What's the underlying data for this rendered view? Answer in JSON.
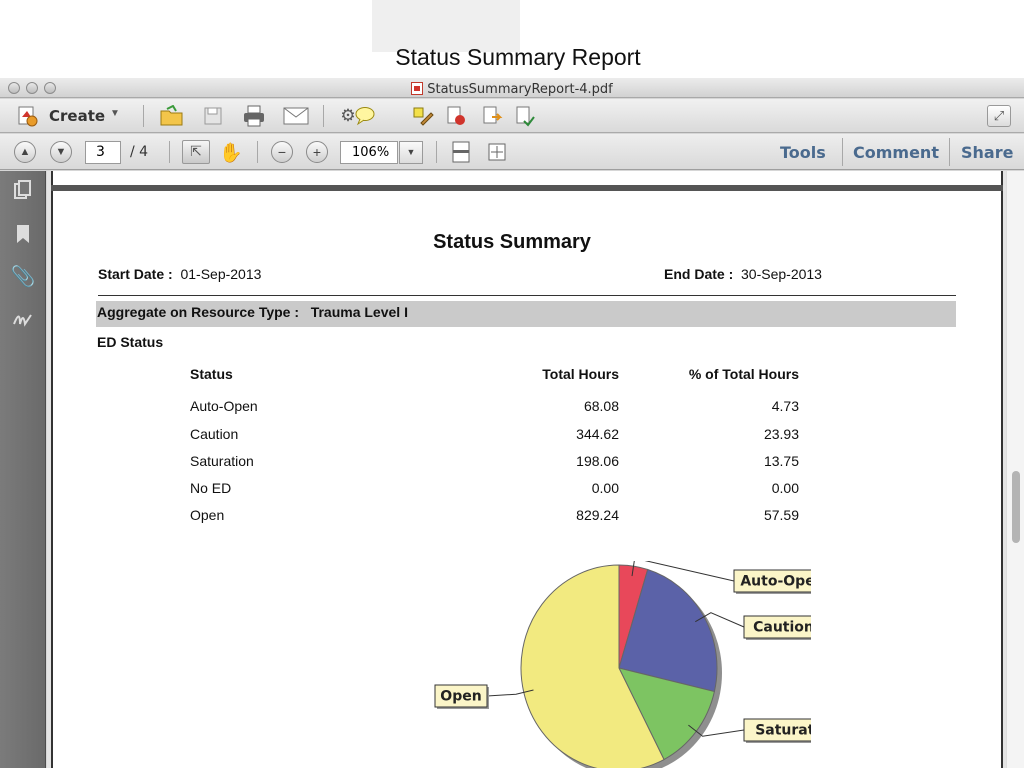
{
  "slide": {
    "title": "Status Summary Report"
  },
  "window": {
    "title": "StatusSummaryReport-4.pdf"
  },
  "toolbar": {
    "create_label": "Create",
    "page_current": "3",
    "page_total": "/ 4",
    "zoom": "106%",
    "tools_label": "Tools",
    "comment_label": "Comment",
    "share_label": "Share"
  },
  "document": {
    "heading": "Status Summary",
    "start_date_label": "Start Date :",
    "start_date": "01-Sep-2013",
    "end_date_label": "End Date  :",
    "end_date": "30-Sep-2013",
    "aggregate_label": "Aggregate on Resource Type :",
    "aggregate_value": "Trauma Level I",
    "section_title": "ED Status",
    "table": {
      "headers": [
        "Status",
        "Total Hours",
        "% of Total Hours"
      ],
      "rows": [
        [
          "Auto-Open",
          "68.08",
          "4.73"
        ],
        [
          "Caution",
          "344.62",
          "23.93"
        ],
        [
          "Saturation",
          "198.06",
          "13.75"
        ],
        [
          "No ED",
          "0.00",
          "0.00"
        ],
        [
          "Open",
          "829.24",
          "57.59"
        ]
      ]
    }
  },
  "chart_data": {
    "type": "pie",
    "slices": [
      {
        "label": "Auto-Open",
        "value": 4.73,
        "color": "#e8485a"
      },
      {
        "label": "Caution",
        "value": 23.93,
        "color": "#5b62a8"
      },
      {
        "label": "Saturation",
        "value": 13.75,
        "color": "#7dc462"
      },
      {
        "label": "No ED",
        "value": 0.0,
        "color": "#cccccc"
      },
      {
        "label": "Open",
        "value": 57.59,
        "color": "#f2ea80"
      }
    ],
    "callouts": [
      "Auto-Open",
      "Caution",
      "Saturation",
      "Open"
    ]
  },
  "colors": {
    "link": "#4a6a8e",
    "aggregate_bg": "#cacaca",
    "callout_bg": "#fbf5c8"
  }
}
